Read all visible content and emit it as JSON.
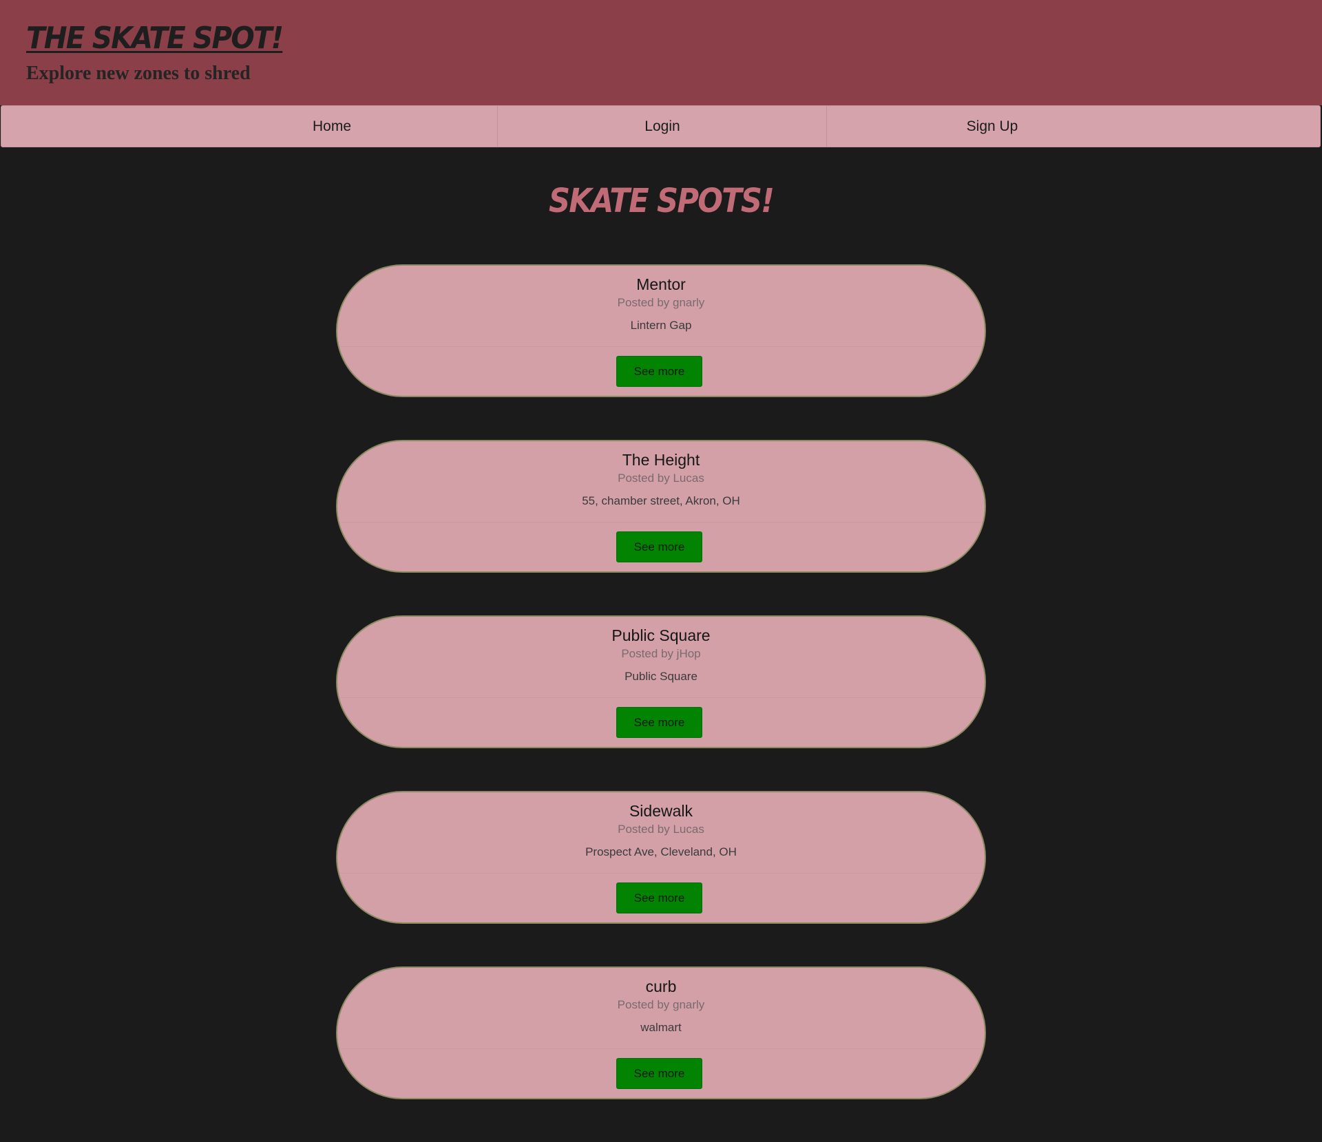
{
  "header": {
    "site_title": "THE SKATE SPOT!",
    "tagline": "Explore new zones to shred"
  },
  "nav": {
    "items": [
      {
        "label": "Home"
      },
      {
        "label": "Login"
      },
      {
        "label": "Sign Up"
      }
    ]
  },
  "main": {
    "title": "SKATE SPOTS!",
    "spots": [
      {
        "name": "Mentor",
        "posted_by": "Posted by gnarly",
        "location": "Lintern Gap",
        "button_label": "See more"
      },
      {
        "name": "The Height",
        "posted_by": "Posted by Lucas",
        "location": "55, chamber street, Akron, OH",
        "button_label": "See more"
      },
      {
        "name": "Public Square",
        "posted_by": "Posted by jHop",
        "location": "Public Square",
        "button_label": "See more"
      },
      {
        "name": "Sidewalk",
        "posted_by": "Posted by Lucas",
        "location": "Prospect Ave, Cleveland, OH",
        "button_label": "See more"
      },
      {
        "name": "curb",
        "posted_by": "Posted by gnarly",
        "location": "walmart",
        "button_label": "See more"
      }
    ]
  },
  "colors": {
    "header_bg": "#8b3f48",
    "nav_bg": "#d5a3ab",
    "page_bg": "#1b1b1b",
    "card_bg": "#d3a0a8",
    "button_bg": "#028302",
    "title_accent": "#c06b76"
  }
}
